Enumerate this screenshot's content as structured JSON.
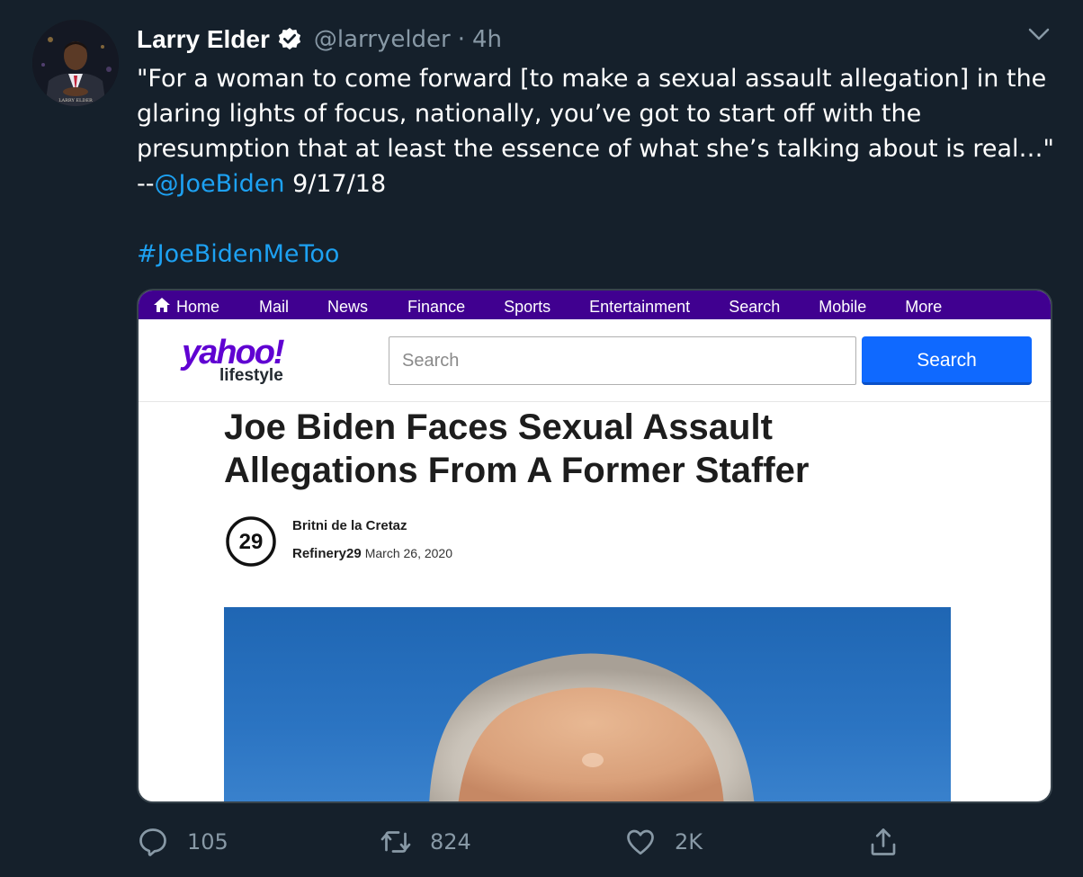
{
  "tweet": {
    "author_name": "Larry Elder",
    "author_handle": "@larryelder",
    "separator": "·",
    "timestamp": "4h",
    "text_lines": [
      "\"For a woman to come forward [to make a sexual assault allegation] in the",
      "glaring lights of focus, nationally, you’ve got to start off with the",
      "presumption that at least the essence of what she’s talking about is real…\""
    ],
    "attribution_prefix": "--",
    "mention": "@JoeBiden",
    "attribution_date": " 9/17/18",
    "hashtag": "#JoeBidenMeToo",
    "avatar_caption": "LARRY ELDER"
  },
  "card": {
    "nav": [
      "Home",
      "Mail",
      "News",
      "Finance",
      "Sports",
      "Entertainment",
      "Search",
      "Mobile",
      "More"
    ],
    "logo_main": "yahoo!",
    "logo_sub": "lifestyle",
    "search_placeholder": "Search",
    "search_button": "Search",
    "headline_lines": [
      "Joe Biden Faces Sexual Assault",
      "Allegations From A Former Staffer"
    ],
    "author": "Britni de la Cretaz",
    "source": "Refinery29",
    "date": "March 26, 2020",
    "publisher_logo_text": "29"
  },
  "actions": {
    "replies": "105",
    "retweets": "824",
    "likes": "2K"
  },
  "colors": {
    "background": "#15202b",
    "link": "#1da1f2",
    "muted": "#8899a6",
    "yahoo_nav": "#400090",
    "yahoo_purple": "#6001d2",
    "search_blue": "#0f69ff"
  }
}
